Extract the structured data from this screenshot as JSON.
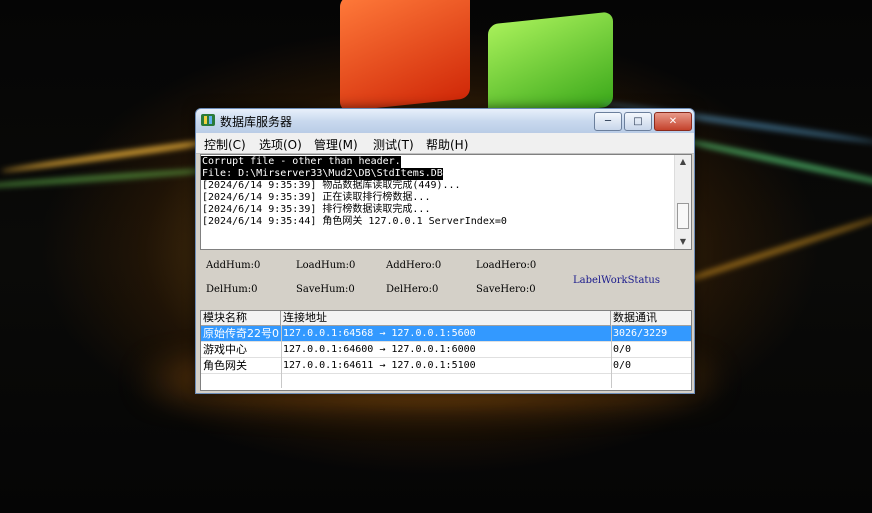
{
  "window": {
    "title": "数据库服务器",
    "buttons": {
      "minimize": "─",
      "maximize": "□",
      "close": "✕"
    }
  },
  "menu": [
    "控制(C)",
    "选项(O)",
    "管理(M)",
    "测试(T)",
    "帮助(H)"
  ],
  "log": [
    {
      "text": "Corrupt file - other than header.",
      "highlight": "black"
    },
    {
      "text": "File: D:\\Mirserver33\\Mud2\\DB\\StdItems.DB",
      "highlight": "black"
    },
    {
      "text": "[2024/6/14 9:35:39] 物品数据库读取完成(449)...",
      "highlight": "none"
    },
    {
      "text": "[2024/6/14 9:35:39] 正在读取排行榜数据...",
      "highlight": "none"
    },
    {
      "text": "[2024/6/14 9:35:39] 排行榜数据读取完成...",
      "highlight": "none"
    },
    {
      "text": "[2024/6/14 9:35:44] 角色网关 127.0.0.1 ServerIndex=0",
      "highlight": "none"
    }
  ],
  "stats": {
    "add_hum": "AddHum:0",
    "load_hum": "LoadHum:0",
    "add_hero": "AddHero:0",
    "load_hero": "LoadHero:0",
    "del_hum": "DelHum:0",
    "save_hum": "SaveHum:0",
    "del_hero": "DelHero:0",
    "save_hero": "SaveHero:0",
    "label_work_status": "LabelWorkStatus"
  },
  "table": {
    "headers": [
      "模块名称",
      "连接地址",
      "数据通讯"
    ],
    "rows": [
      {
        "name": "原始传奇22号0",
        "address": "127.0.0.1:64568 → 127.0.0.1:5600",
        "data": "3026/3229",
        "selected": true
      },
      {
        "name": "游戏中心",
        "address": "127.0.0.1:64600 → 127.0.0.1:6000",
        "data": "0/0",
        "selected": false
      },
      {
        "name": "角色网关",
        "address": "127.0.0.1:64611 → 127.0.0.1:5100",
        "data": "0/0",
        "selected": false
      }
    ]
  },
  "colors": {
    "selection": "#3399ff",
    "log_highlight": "#000000",
    "label_work_status": "#1a1a8c"
  }
}
